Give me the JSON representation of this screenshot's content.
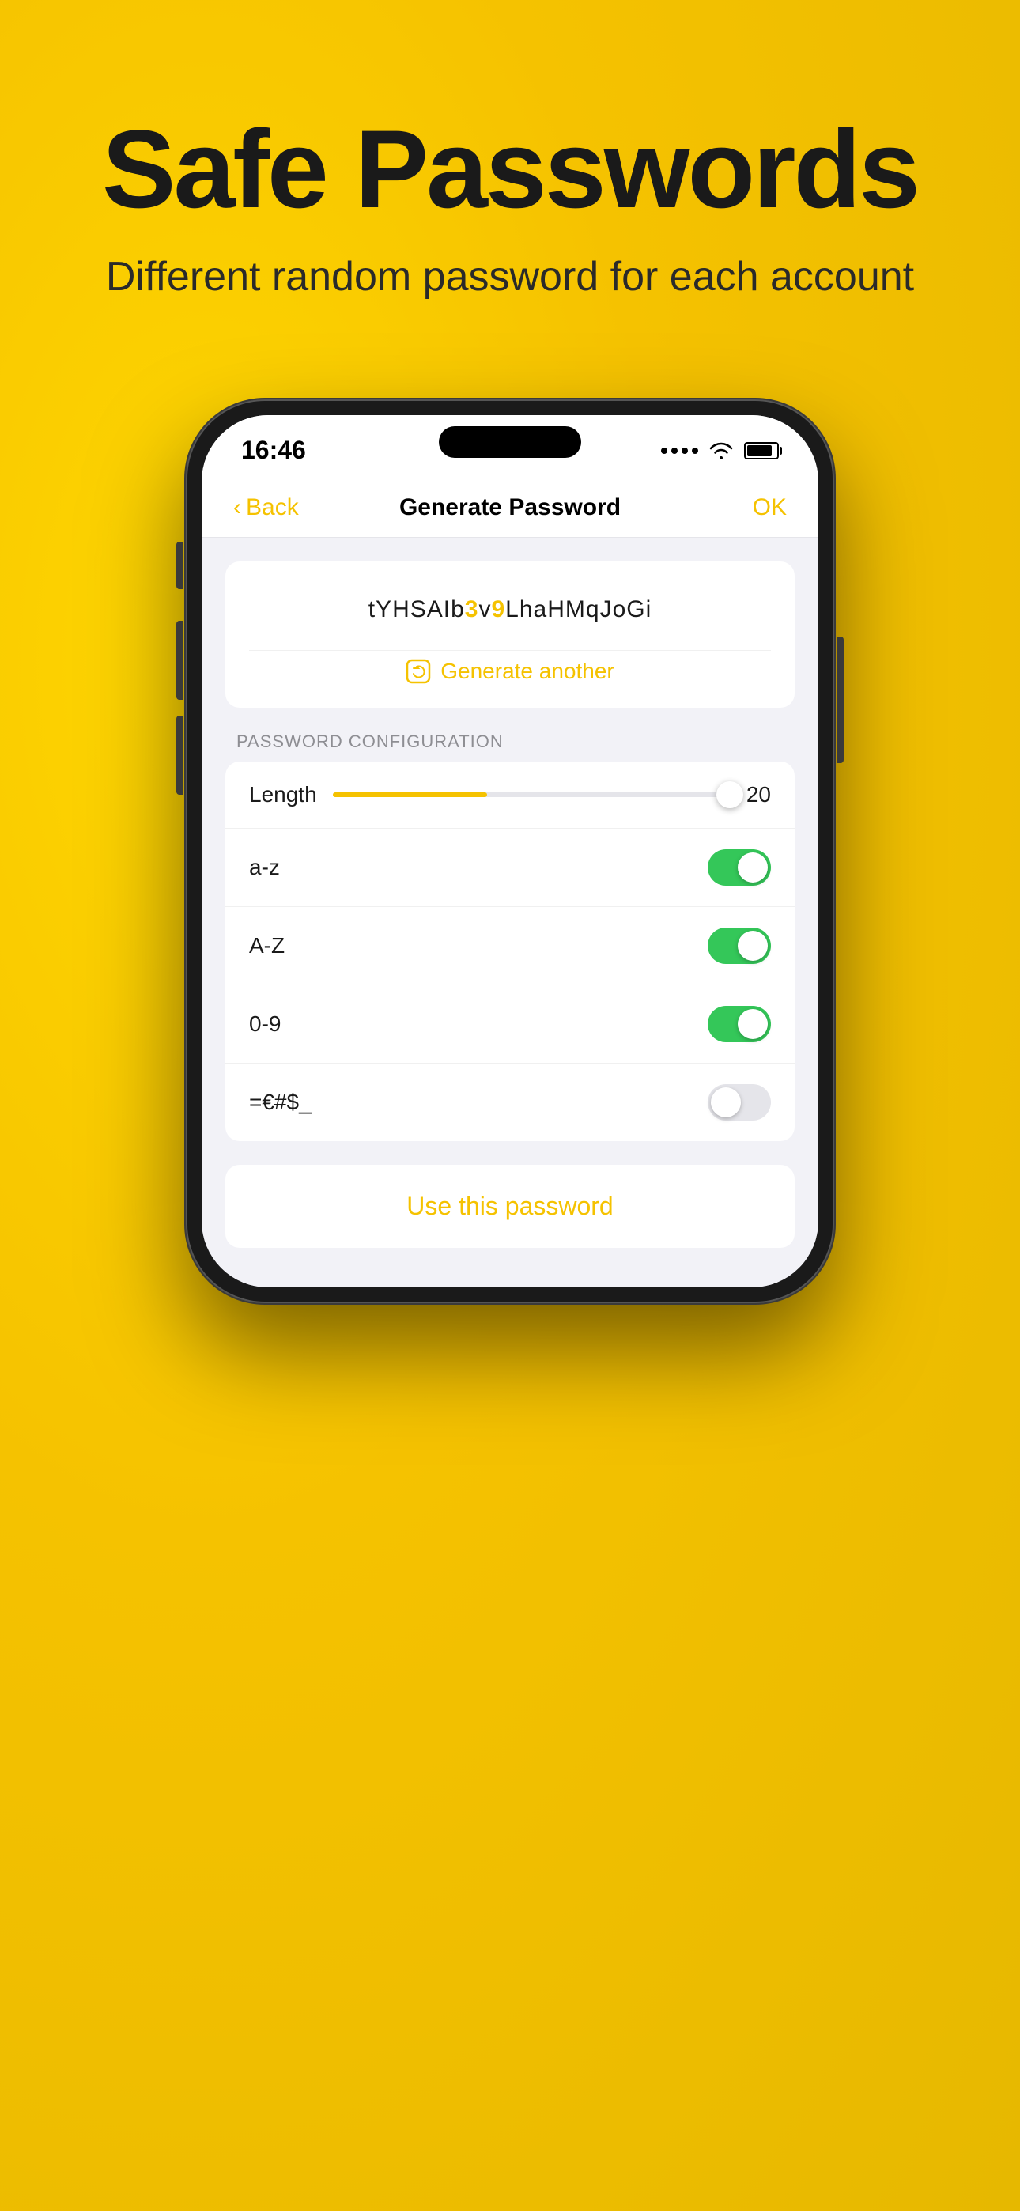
{
  "background": {
    "color": "#F5C200"
  },
  "header": {
    "title": "Safe Passwords",
    "subtitle": "Different random password for each account"
  },
  "status_bar": {
    "time": "16:46",
    "signal": "...",
    "wifi": true,
    "battery": 85
  },
  "nav": {
    "back_label": "Back",
    "title": "Generate Password",
    "ok_label": "OK"
  },
  "password": {
    "display": "tYHSAIb3v9LhaHMqJoGi",
    "generate_label": "Generate another"
  },
  "config": {
    "section_label": "PASSWORD CONFIGURATION",
    "length_label": "Length",
    "length_value": "20",
    "rows": [
      {
        "label": "a-z",
        "enabled": true
      },
      {
        "label": "A-Z",
        "enabled": true
      },
      {
        "label": "0-9",
        "enabled": true
      },
      {
        "label": "=€#$_",
        "enabled": false
      }
    ]
  },
  "use_password": {
    "label": "Use this password"
  }
}
